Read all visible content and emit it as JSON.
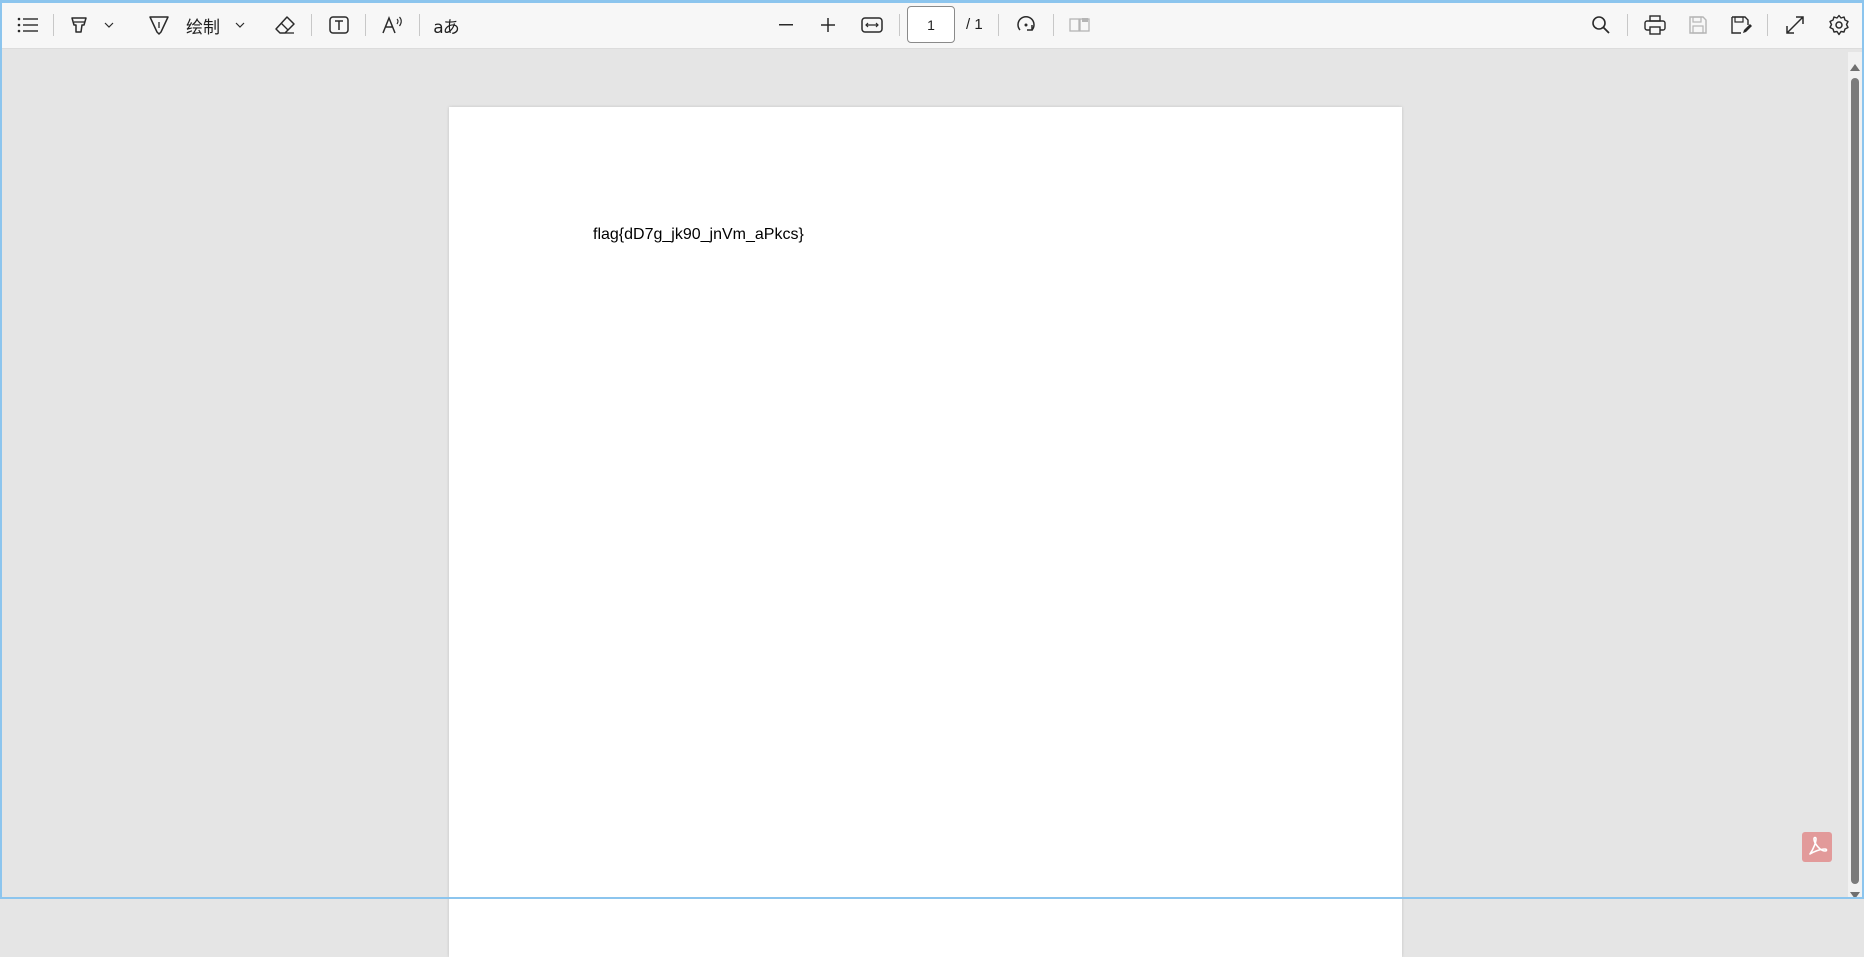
{
  "toolbar": {
    "contents_icon": "contents-list-icon",
    "highlight_icon": "highlighter-icon",
    "draw_icon": "draw-pen-icon",
    "draw_label": "绘制",
    "erase_icon": "eraser-icon",
    "text_icon": "add-text-icon",
    "read_aloud_icon": "read-aloud-icon",
    "translate_label": "aあ",
    "zoom_out_icon": "minus-icon",
    "zoom_in_icon": "plus-icon",
    "fit_icon": "fit-width-icon",
    "page_number": "1",
    "page_total": "/ 1",
    "rotate_icon": "rotate-icon",
    "two_page_icon": "page-view-icon",
    "search_icon": "search-icon",
    "print_icon": "printer-icon",
    "save_icon": "save-icon",
    "save_as_icon": "save-as-icon",
    "fullscreen_icon": "expand-icon",
    "settings_icon": "gear-icon"
  },
  "document": {
    "text": "flag{dD7g_jk90_jnVm_aPkcs}"
  },
  "colors": {
    "viewer_bg": "#e5e5e5",
    "toolbar_bg": "#f7f7f7",
    "window_border": "#8cc5ee",
    "pdf_badge": "#e29a9a"
  }
}
